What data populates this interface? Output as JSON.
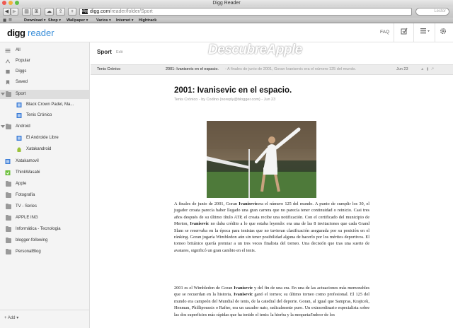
{
  "browser": {
    "window_title": "Digg Reader",
    "url_host": "digg.com",
    "url_path": "/reader/folder/Sport",
    "favicon_text": "digg",
    "search_placeholder": "Lector",
    "bookmarks": [
      "Download ▾",
      "Shop ▾",
      "Wallpaper ▾",
      "Varios ▾",
      "Internet ▾",
      "Hightrack"
    ]
  },
  "header": {
    "logo_digg": "digg",
    "logo_reader": "reader",
    "faq": "FAQ",
    "icons": [
      "checkmark-icon",
      "list-menu-icon",
      "gear-icon"
    ]
  },
  "sidebar": {
    "items": [
      {
        "label": "All",
        "icon": "all-icon"
      },
      {
        "label": "Popular",
        "icon": "popular-icon"
      },
      {
        "label": "Diggs",
        "icon": "digg-icon"
      },
      {
        "label": "Saved",
        "icon": "saved-icon"
      },
      {
        "label": "Sport",
        "icon": "folder-icon",
        "active": true
      },
      {
        "label": "Black Crown Padel, Ma...",
        "icon": "feed-icon"
      },
      {
        "label": "Tenis Crónico",
        "icon": "feed-icon"
      },
      {
        "label": "Android",
        "icon": "folder-icon"
      },
      {
        "label": "El Androide Libre",
        "icon": "feed-icon"
      },
      {
        "label": "Xatakandroid",
        "icon": "android-icon"
      },
      {
        "label": "Xatakamovil",
        "icon": "feed-icon"
      },
      {
        "label": "ThinkWasabi",
        "icon": "feed-icon"
      },
      {
        "label": "Apple",
        "icon": "folder-icon"
      },
      {
        "label": "Fotografía",
        "icon": "folder-icon"
      },
      {
        "label": "TV - Series",
        "icon": "folder-icon"
      },
      {
        "label": "APPLE ING",
        "icon": "folder-icon"
      },
      {
        "label": "Informática - Tecnologia",
        "icon": "folder-icon"
      },
      {
        "label": "blogger-following",
        "icon": "folder-icon"
      },
      {
        "label": "PersonalBlog",
        "icon": "folder-icon"
      }
    ],
    "add_label": "Add",
    "watermark": "DescubreApple"
  },
  "main": {
    "section_title": "Sport",
    "edit_label": "Edit",
    "row": {
      "source": "Tenis Crónico",
      "title": "2001: Ivanisevic en el espacio.",
      "snippet": "- A finales de junio de 2001, Goran Ivanisevic era el número 125 del mundo.",
      "date": "Jun 23"
    },
    "article": {
      "title": "2001: Ivanisevic en el espacio.",
      "meta": "Tenis Crónico - by Codino (noreply@blogger.com) - Jun 23",
      "p1_a": "A finales de junio de 2001, Goran ",
      "p1_b": "Ivanisevic",
      "p1_c": "era el número 125 del mundo. A punto de cumplir los 30, el jugador croata parecía haber llegado una gran carrera que no parecía tener continuidad o reinicio. Casi tres años después de su último título ATP, el croata recibe una notificación. Con el certificado del municipio de Merton, ",
      "p1_d": "Ivanisevic",
      "p1_e": " no daba crédito a lo que estaba leyendo: era una de las 8 invitaciones que cada Grand Slam se reservaba en la época para tenistas que no tuvieran clasificación asegurada por su posición en el ránking. Goran jugaría Wimbledon aún sin tener posibilidad alguna de hacerlo por los méritos deportivos. El torneo británico quería premiar a un tres veces finalista del torneo. Una decisión que tras una suerte de avatares, significó un gran cambio en el tenis.",
      "p2_a": "2001 es el Wimbledon de Goran ",
      "p2_b": "Ivanisevic",
      "p2_c": " y del fin de una era. En una de las actuaciones más memorables que se recuerdan en la historia, ",
      "p2_d": "Ivanisevic",
      "p2_e": " ganó el torneo; su último torneo como profesional. El 125 del mundo era campeón del Mundial de tenis, de la catedral del deporte. Goran, al igual que Sampras, Krajicek, Henman, Phillipoussis o Rafter, era un sacador nato, radicalmente puro. Un extraordinario especialista sobre las dos superficies más rápidas que ha tenido el tenis: la hierba y la moqueta/Indoor de los"
    }
  }
}
